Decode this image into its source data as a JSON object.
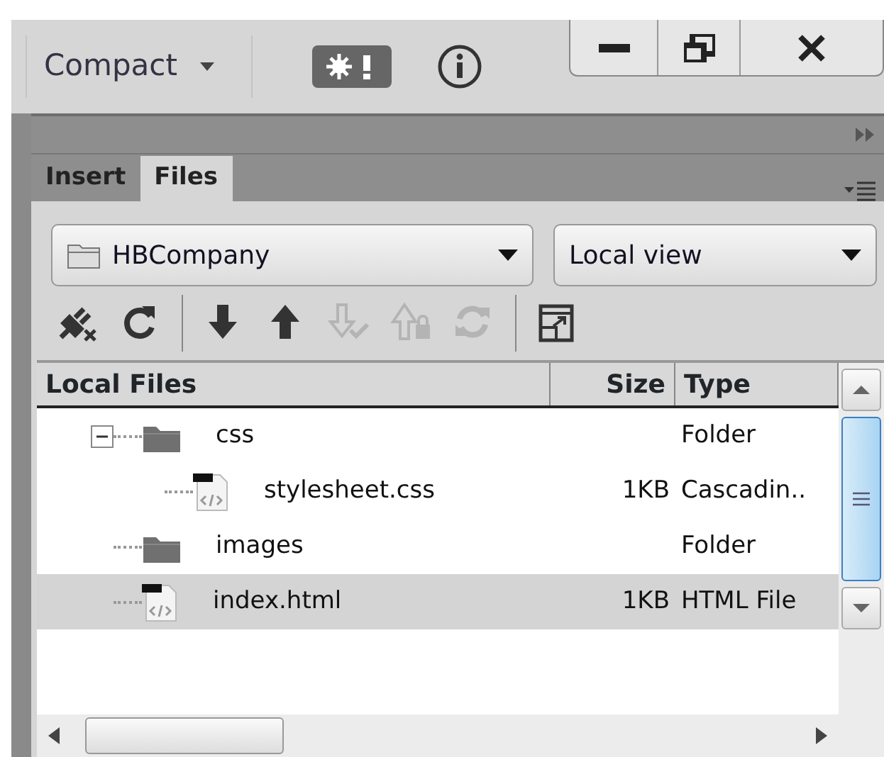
{
  "workspace": {
    "label": "Compact",
    "window_controls": [
      {
        "kind": "minimize"
      },
      {
        "kind": "restore"
      },
      {
        "kind": "close"
      }
    ]
  },
  "panel": {
    "tabs": [
      {
        "label": "Insert",
        "selected": false
      },
      {
        "label": "Files",
        "selected": true
      }
    ],
    "site": {
      "value": "HBCompany"
    },
    "view": {
      "value": "Local view"
    },
    "toolbar": [
      {
        "kind": "disconnect",
        "disabled": false
      },
      {
        "kind": "refresh",
        "disabled": false
      },
      {
        "kind": "separator"
      },
      {
        "kind": "get",
        "disabled": false
      },
      {
        "kind": "put",
        "disabled": false
      },
      {
        "kind": "checkin",
        "disabled": true
      },
      {
        "kind": "checkout",
        "disabled": true
      },
      {
        "kind": "sync",
        "disabled": true
      },
      {
        "kind": "separator"
      },
      {
        "kind": "expand",
        "disabled": false
      }
    ],
    "columns": [
      "Local Files",
      "Size",
      "Type"
    ],
    "tree": [
      {
        "kind": "folder",
        "name": "css",
        "type": "Folder",
        "expanded": true,
        "selected": false,
        "children": [
          {
            "kind": "file",
            "name": "stylesheet.css",
            "size": "1KB",
            "type": "Cascadin..",
            "selected": false
          }
        ]
      },
      {
        "kind": "folder",
        "name": "images",
        "type": "Folder",
        "selected": false
      },
      {
        "kind": "file",
        "name": "index.html",
        "size": "1KB",
        "type": "HTML File",
        "selected": true
      }
    ]
  }
}
